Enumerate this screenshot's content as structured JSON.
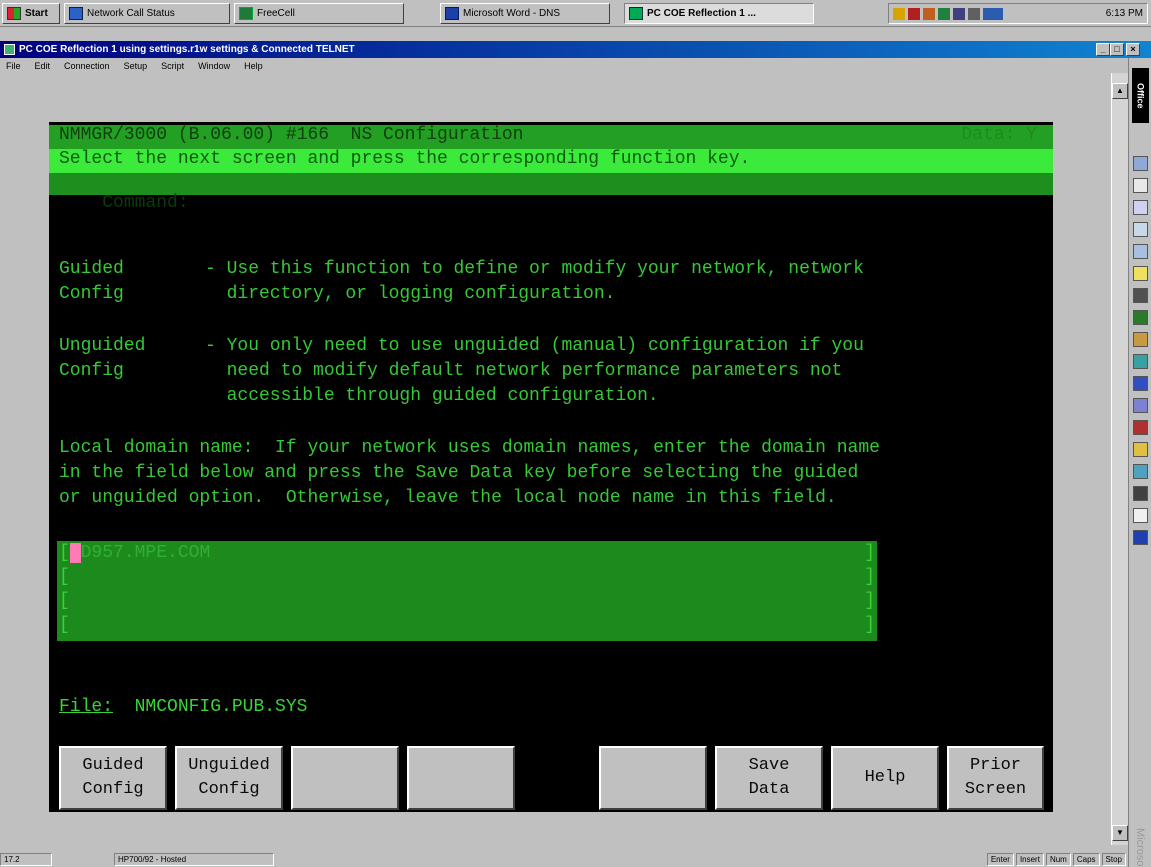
{
  "taskbar": {
    "start": "Start",
    "buttons": [
      {
        "label": "Network Call Status"
      },
      {
        "label": "FreeCell"
      },
      {
        "label": "Microsoft Word - DNS"
      },
      {
        "label": "PC COE Reflection 1 ..."
      }
    ],
    "clock": "6:13 PM"
  },
  "window": {
    "title": "PC COE Reflection 1 using settings.r1w settings & Connected TELNET",
    "menu": [
      "File",
      "Edit",
      "Connection",
      "Setup",
      "Script",
      "Window",
      "Help"
    ]
  },
  "terminal": {
    "header_left": "NMMGR/3000 (B.06.00) #166  NS Configuration",
    "header_right": "Data: Y",
    "prompt": "Select the next screen and press the corresponding function key.",
    "command_label": "Command:",
    "guided": {
      "key1": "Guided",
      "key2": "Config",
      "line1": "- Use this function to define or modify your network, network",
      "line2": "  directory, or logging configuration."
    },
    "unguided": {
      "key1": "Unguided",
      "key2": "Config",
      "line1": "- You only need to use unguided (manual) configuration if you",
      "line2": "  need to modify default network performance parameters not",
      "line3": "  accessible through guided configuration."
    },
    "domain_text": [
      "Local domain name:  If your network uses domain names, enter the domain name",
      "in the field below and press the Save Data key before selecting the guided",
      "or unguided option.  Otherwise, leave the local node name in this field."
    ],
    "domain_field": {
      "cursor_char": "E",
      "value": "D957.MPE.COM",
      "bracket_open": "[",
      "bracket_close": "]"
    },
    "file_label": "File:",
    "file_value": "NMCONFIG.PUB.SYS"
  },
  "fkeys": [
    {
      "line1": "Guided",
      "line2": "Config"
    },
    {
      "line1": "Unguided",
      "line2": "Config"
    },
    {
      "line1": "",
      "line2": ""
    },
    {
      "line1": "",
      "line2": ""
    },
    {
      "line1": "",
      "line2": ""
    },
    {
      "line1": "Save",
      "line2": "Data"
    },
    {
      "line1": "Help",
      "line2": ""
    },
    {
      "line1": "Prior",
      "line2": "Screen"
    }
  ],
  "officebar": {
    "title": "Office",
    "watermark": "Microsoft"
  },
  "statusbar": {
    "position": "17.2",
    "terminal_type": "HP700/92 - Hosted",
    "indicators": [
      "Enter",
      "Insert",
      "Num",
      "Caps",
      "Stop"
    ]
  },
  "colors": {
    "terminal_bg": "#000000",
    "terminal_text": "#39d339",
    "header_bar": "#23a023",
    "prompt_bar": "#3bea3b",
    "field_bg": "#1c8a1c",
    "cursor": "#ff7bb5",
    "title_bar": "#000080"
  }
}
